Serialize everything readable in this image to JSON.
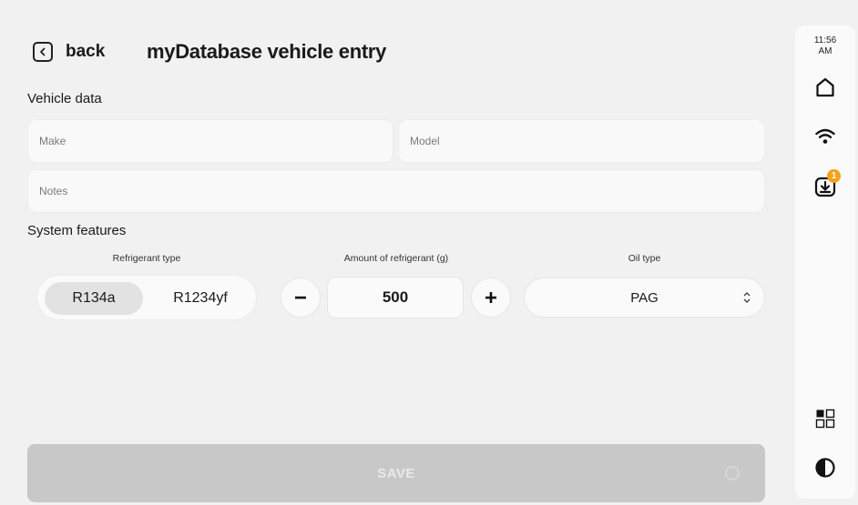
{
  "header": {
    "back_label": "back",
    "title": "myDatabase vehicle entry"
  },
  "vehicle_data": {
    "section_title": "Vehicle data",
    "make_placeholder": "Make",
    "model_placeholder": "Model",
    "notes_placeholder": "Notes"
  },
  "system_features": {
    "section_title": "System features",
    "refrigerant_type": {
      "label": "Refrigerant type",
      "options": [
        "R134a",
        "R1234yf"
      ],
      "selected": "R134a"
    },
    "amount": {
      "label": "Amount of refrigerant (g)",
      "value": "500"
    },
    "oil_type": {
      "label": "Oil type",
      "value": "PAG"
    }
  },
  "save_label": "SAVE",
  "rail": {
    "time_line1": "11:56",
    "time_line2": "AM",
    "download_badge": "1",
    "icons": [
      "home-icon",
      "wifi-icon",
      "download-icon",
      "apps-grid-icon",
      "contrast-icon"
    ]
  }
}
